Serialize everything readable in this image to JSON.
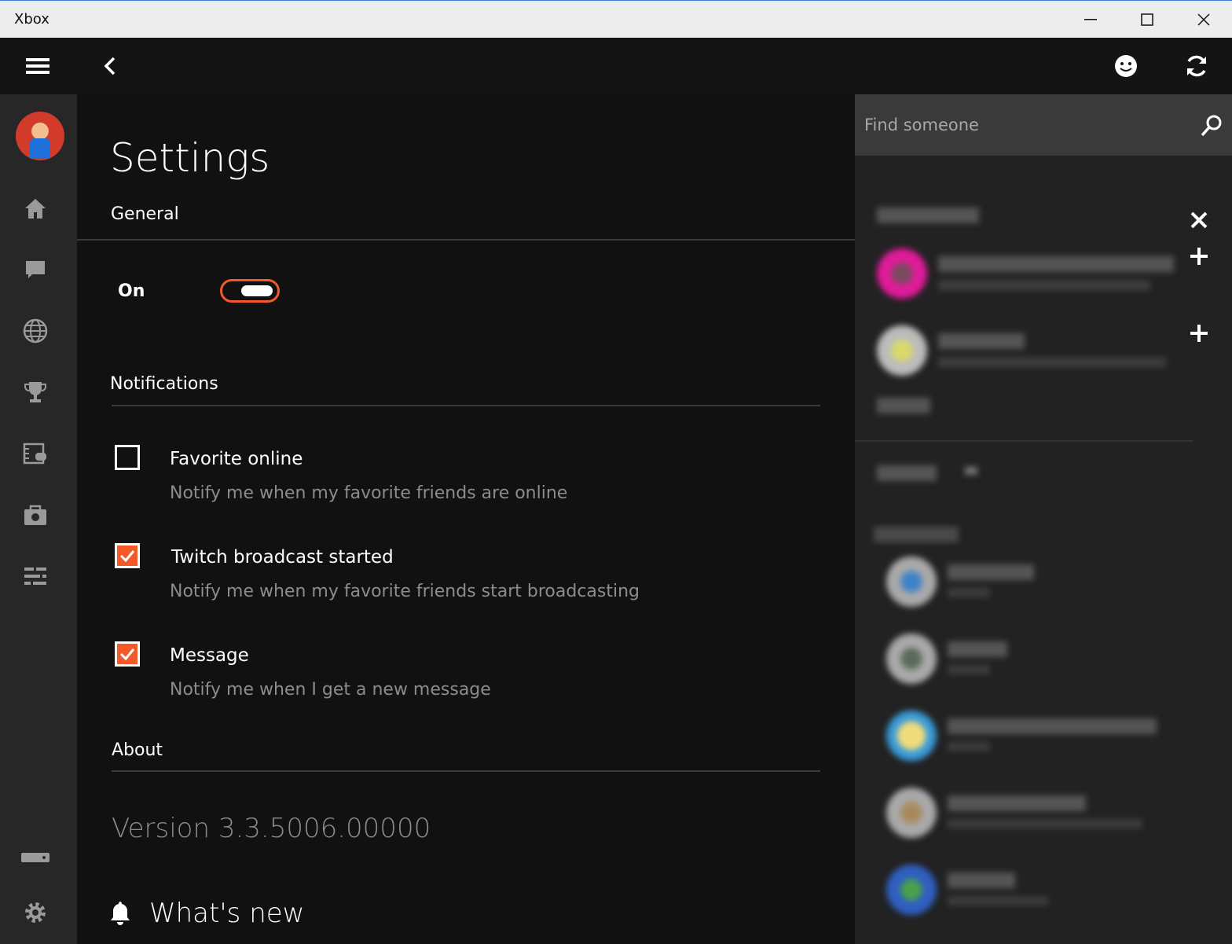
{
  "window": {
    "title": "Xbox",
    "minimize_icon": "minimize-icon",
    "maximize_icon": "maximize-icon",
    "close_icon": "close-icon"
  },
  "appbar": {
    "menu_icon": "hamburger-icon",
    "back_icon": "back-arrow-icon",
    "emoji_icon": "smiley-icon",
    "refresh_icon": "refresh-icon"
  },
  "nav": {
    "items": [
      "home-icon",
      "messages-icon",
      "globe-icon",
      "trophy-icon",
      "game-dvr-icon",
      "store-icon",
      "activity-feed-icon"
    ],
    "bottom": [
      "connect-console-icon",
      "settings-gear-icon"
    ]
  },
  "settings": {
    "title": "Settings",
    "general_label": "General",
    "toggle_label": "On",
    "toggle_state": true,
    "notifications_label": "Notifications",
    "options": [
      {
        "title": "Favorite online",
        "desc": "Notify me when my favorite friends are online",
        "checked": false
      },
      {
        "title": "Twitch broadcast started",
        "desc": "Notify me when my favorite friends start broadcasting",
        "checked": true
      },
      {
        "title": "Message",
        "desc": "Notify me when I get a new message",
        "checked": true
      }
    ],
    "about_label": "About",
    "version": "Version 3.3.5006.00000",
    "whats_new": "What's new"
  },
  "people": {
    "search_placeholder": "Find someone",
    "accent": "#f25a29"
  }
}
